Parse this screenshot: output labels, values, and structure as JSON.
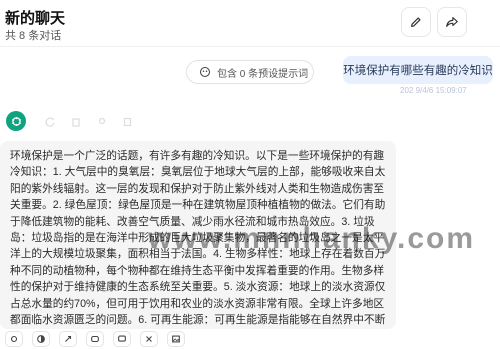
{
  "header": {
    "title": "新的聊天",
    "subtitle": "共 8 条对话",
    "edit_icon": "pencil-icon",
    "share_icon": "share-icon"
  },
  "prompt_chip": {
    "label": "包含 0 条预设提示词",
    "icon": "mask-icon"
  },
  "user_message": {
    "text": "环境保护有哪些有趣的冷知识",
    "meta": "202 9/4/6 15:09:07"
  },
  "assistant": {
    "avatar": "openai-logo-icon",
    "answer": "环境保护是一个广泛的话题，有许多有趣的冷知识。以下是一些环境保护的有趣冷知识：1. 大气层中的臭氧层：臭氧层位于地球大气层的上部，能够吸收来自太阳的紫外线辐射。这一层的发现和保护对于防止紫外线对人类和生物造成伤害至关重要。2. 绿色屋顶：绿色屋顶是一种在建筑物屋顶种植植物的做法。它们有助于降低建筑物的能耗、改善空气质量、减少雨水径流和城市热岛效应。3. 垃圾岛：垃圾岛指的是在海洋中形成的巨大垃圾聚集物，最著名的垃圾岛之一是太平洋上的大规模垃圾聚集，面积相当于法国。4. 生物多样性：地球上存在着数百万种不同的动植物种，每个物种都在维持生态平衡中发挥着重要的作用。生物多样性的保护对于维持健康的生态系统至关重要。5. 淡水资源：地球上的淡水资源仅占总水量的约70%，但可用于饮用和农业的淡水资源非常有限。全球上许多地区都面临水资源匮乏的问题。6. 可再生能源：可再生能源是指能够在自然界中不断补充的能源，如"
  },
  "watermark": "www.mnnhanky.com",
  "toolbar": {
    "buttons": [
      "settings-icon",
      "theme-icon",
      "prompt-icon",
      "mask-icon",
      "chat-icon",
      "clear-icon",
      "image-icon"
    ]
  },
  "colors": {
    "user_bubble": "#e8f0fe",
    "answer_bg": "#f5f5f5",
    "avatar": "#10a37f"
  }
}
